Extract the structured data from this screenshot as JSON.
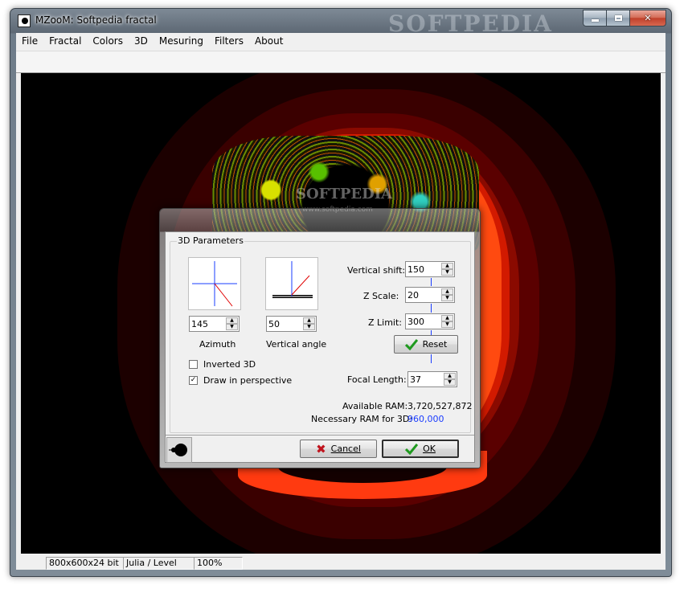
{
  "window": {
    "title": "MZooM: Softpedia fractal",
    "watermark": "SOFTPEDIA"
  },
  "menu": [
    "File",
    "Fractal",
    "Colors",
    "3D",
    "Mesuring",
    "Filters",
    "About"
  ],
  "canvas": {
    "watermark_text": "SOFTPEDIA",
    "watermark_url": "www.softpedia.com"
  },
  "status": {
    "resolution": "800x600x24 bit",
    "mode": "Julia / Level",
    "zoom": "100%"
  },
  "dialog": {
    "group_title": "3D Parameters",
    "azimuth": {
      "label": "Azimuth",
      "value": "145"
    },
    "vertical_angle": {
      "label": "Vertical angle",
      "value": "50"
    },
    "inverted_3d": {
      "label": "Inverted 3D",
      "checked": false
    },
    "perspective": {
      "label": "Draw in perspective",
      "checked": true,
      "mark": "✓"
    },
    "vertical_shift": {
      "label": "Vertical shift:",
      "value": "150"
    },
    "z_scale": {
      "label": "Z Scale:",
      "value": "20"
    },
    "z_limit": {
      "label": "Z Limit:",
      "value": "300"
    },
    "reset_label": "Reset",
    "focal_length": {
      "label": "Focal Length:",
      "value": "37"
    },
    "available_ram": {
      "label": "Available RAM:",
      "value": "3,720,527,872"
    },
    "necessary_ram": {
      "label": "Necessary RAM for 3D:",
      "value": "960,000"
    },
    "cancel_label": "Cancel",
    "ok_label": "OK"
  },
  "colors": {
    "accent_blue": "#1a3cff",
    "check_green": "#1f9a1f",
    "cancel_red": "#c0141e"
  }
}
